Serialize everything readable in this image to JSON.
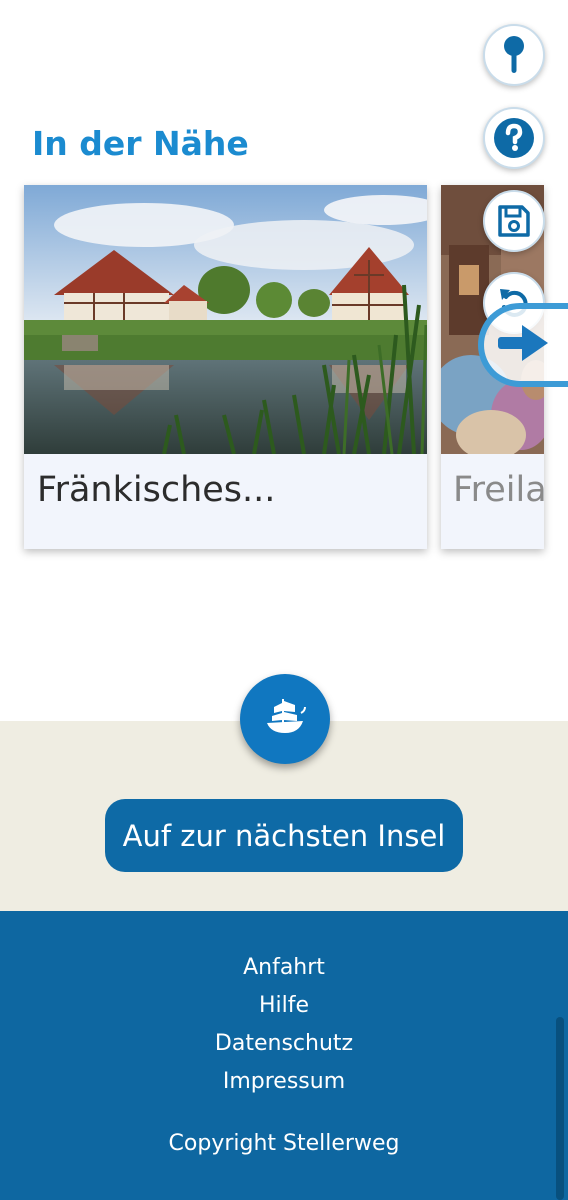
{
  "section": {
    "title": "In der Nähe"
  },
  "cards": [
    {
      "title": "Fränkisches..."
    },
    {
      "title": "Freilar"
    }
  ],
  "actions": {
    "next_island_label": "Auf zur nächsten Insel"
  },
  "footer": {
    "links": [
      "Anfahrt",
      "Hilfe",
      "Datenschutz",
      "Impressum"
    ],
    "copyright": "Copyright Stellerweg"
  },
  "icons": {
    "map_pin": "map-pin-icon",
    "help": "help-icon",
    "save": "save-icon",
    "undo": "undo-icon",
    "next": "arrow-right-icon",
    "ship": "ship-icon"
  },
  "colors": {
    "accent": "#1b8bd0",
    "primary_button": "#0e6aa6",
    "footer_bg": "#0e67a1",
    "band_bg": "#efede2"
  }
}
